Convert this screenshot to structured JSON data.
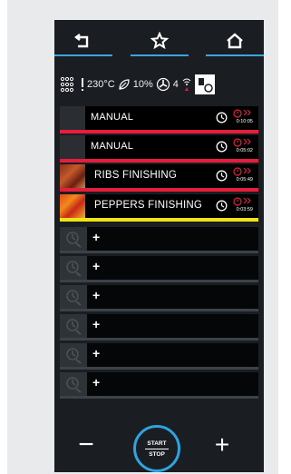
{
  "status": {
    "temperature": "230°C",
    "humidity": "10%",
    "fan_speed": "4"
  },
  "programs": [
    {
      "label": "MANUAL",
      "time": "0:10:05",
      "bar_color": "#e61e3c",
      "thumb": "empty"
    },
    {
      "label": "MANUAL",
      "time": "0:05:02",
      "bar_color": "#e61e3c",
      "thumb": "empty"
    },
    {
      "label": "RIBS FINISHING",
      "time": "0:05:49",
      "bar_color": "#e61e3c",
      "thumb": "food-ribs"
    },
    {
      "label": "PEPPERS FINISHING",
      "time": "0:03:59",
      "bar_color": "#f0e414",
      "thumb": "food-peppers"
    }
  ],
  "empty_slots": [
    {
      "label": "+"
    },
    {
      "label": "+"
    },
    {
      "label": "+"
    },
    {
      "label": "+"
    },
    {
      "label": "+"
    },
    {
      "label": "+"
    }
  ],
  "controls": {
    "minus": "−",
    "plus": "+",
    "start": "START",
    "stop": "STOP"
  },
  "colors": {
    "accent": "#3aa6dc",
    "alert": "#e61e3c",
    "warning": "#f0e414",
    "screen_bg": "#1a1d21"
  }
}
